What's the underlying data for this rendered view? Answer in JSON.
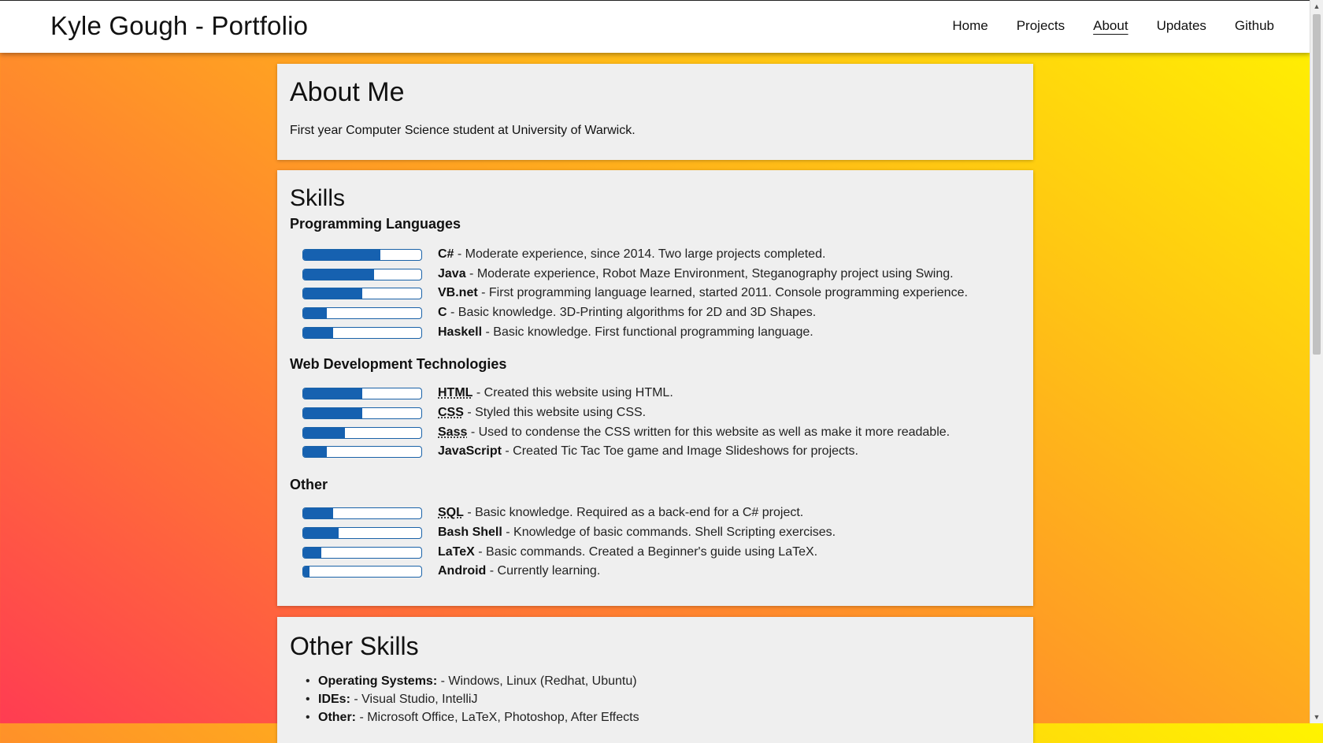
{
  "header": {
    "site_title": "Kyle Gough - Portfolio",
    "nav": [
      {
        "label": "Home",
        "active": false
      },
      {
        "label": "Projects",
        "active": false
      },
      {
        "label": "About",
        "active": true
      },
      {
        "label": "Updates",
        "active": false
      },
      {
        "label": "Github",
        "active": false
      }
    ]
  },
  "about": {
    "title": "About Me",
    "text": "First year Computer Science student at University of Warwick."
  },
  "skills": {
    "title": "Skills",
    "categories": [
      {
        "title": "Programming Languages",
        "items": [
          {
            "name": "C#",
            "desc": " - Moderate experience, since 2014. Two large projects completed.",
            "level": 0.65,
            "abbr": false
          },
          {
            "name": "Java",
            "desc": " - Moderate experience, Robot Maze Environment, Steganography project using Swing.",
            "level": 0.6,
            "abbr": false
          },
          {
            "name": "VB.net",
            "desc": " - First programming language learned, started 2011. Console programming experience.",
            "level": 0.5,
            "abbr": false
          },
          {
            "name": "C",
            "desc": " - Basic knowledge. 3D-Printing algorithms for 2D and 3D Shapes.",
            "level": 0.2,
            "abbr": false
          },
          {
            "name": "Haskell",
            "desc": " - Basic knowledge. First functional programming language.",
            "level": 0.25,
            "abbr": false
          }
        ]
      },
      {
        "title": "Web Development Technologies",
        "items": [
          {
            "name": "HTML",
            "desc": " - Created this website using HTML.",
            "level": 0.5,
            "abbr": true
          },
          {
            "name": "CSS",
            "desc": " - Styled this website using CSS.",
            "level": 0.5,
            "abbr": true
          },
          {
            "name": "Sass",
            "desc": " - Used to condense the CSS written for this website as well as make it more readable.",
            "level": 0.35,
            "abbr": true
          },
          {
            "name": "JavaScript",
            "desc": " - Created Tic Tac Toe game and Image Slideshows for projects.",
            "level": 0.2,
            "abbr": false
          }
        ]
      },
      {
        "title": "Other",
        "items": [
          {
            "name": "SQL",
            "desc": " - Basic knowledge. Required as a back-end for a C# project.",
            "level": 0.25,
            "abbr": true
          },
          {
            "name": "Bash Shell",
            "desc": " - Knowledge of basic commands. Shell Scripting exercises.",
            "level": 0.3,
            "abbr": false
          },
          {
            "name": "LaTeX",
            "desc": " - Basic commands. Created a Beginner's guide using LaTeX.",
            "level": 0.15,
            "abbr": false
          },
          {
            "name": "Android",
            "desc": " - Currently learning.",
            "level": 0.05,
            "abbr": false
          }
        ]
      }
    ]
  },
  "other_skills": {
    "title": "Other Skills",
    "items": [
      {
        "label": "Operating Systems:",
        "text": " - Windows, Linux (Redhat, Ubuntu)"
      },
      {
        "label": "IDEs:",
        "text": " - Visual Studio, IntelliJ"
      },
      {
        "label": "Other:",
        "text": " - Microsoft Office, LaTeX, Photoshop, After Effects"
      }
    ]
  },
  "scrollbar": {
    "up_icon": "scroll-up-arrow-icon",
    "down_icon": "scroll-down-arrow-icon"
  }
}
